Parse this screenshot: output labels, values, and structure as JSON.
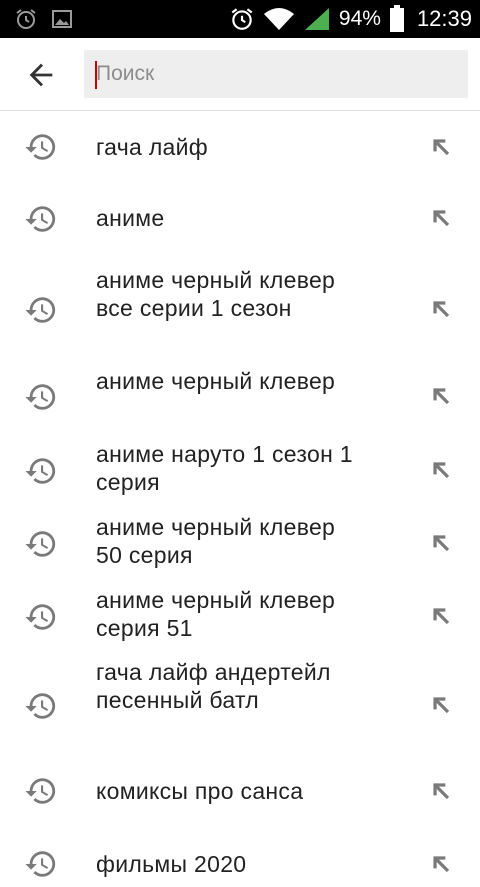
{
  "status_bar": {
    "battery_text": "94%",
    "time": "12:39",
    "icons": [
      "alarm-icon",
      "image-icon",
      "alarm-icon",
      "wifi-icon",
      "signal-icon",
      "battery-icon"
    ]
  },
  "header": {
    "search_placeholder": "Поиск",
    "search_value": "",
    "back_icon": "arrow-back-icon"
  },
  "colors": {
    "status_bar_bg": "#000000",
    "caret": "#cc0000",
    "search_box_bg": "#eeeeee",
    "icon_gray": "#7a7a7a",
    "text": "#222222"
  },
  "history": [
    {
      "text": "гача лайф"
    },
    {
      "text": "аниме"
    },
    {
      "text": "аниме черный клевер все серии 1 сезон"
    },
    {
      "text": "аниме черный клевер"
    },
    {
      "text": "аниме наруто 1 сезон 1 серия"
    },
    {
      "text": "аниме черный клевер 50 серия"
    },
    {
      "text": "аниме черный клевер серия 51"
    },
    {
      "text": "гача лайф андертейл песенный батл"
    },
    {
      "text": "комиксы про санса"
    },
    {
      "text": "фильмы 2020"
    }
  ]
}
